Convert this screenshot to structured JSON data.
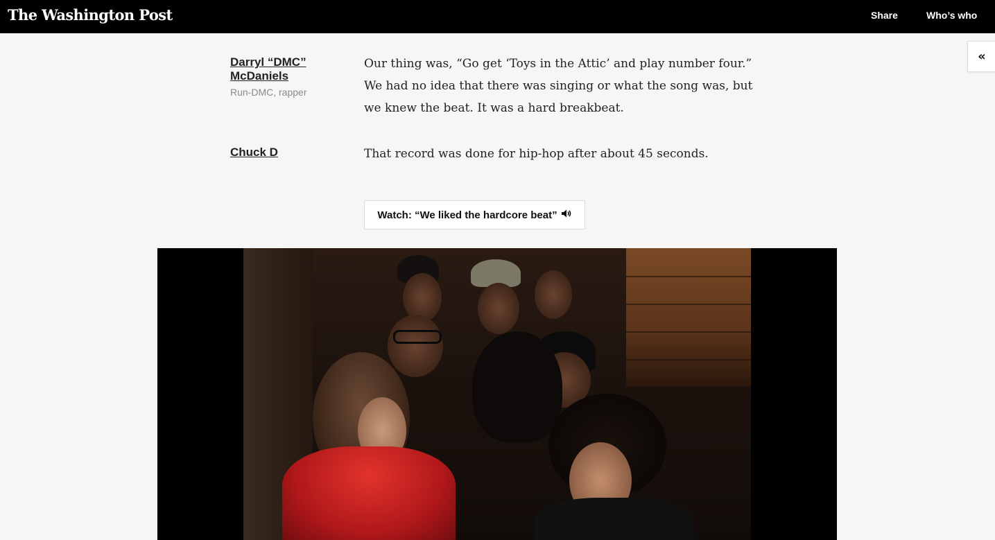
{
  "header": {
    "logo": "The Washington Post",
    "nav": {
      "share": "Share",
      "whos_who": "Who’s who"
    }
  },
  "sidebar_toggle": {
    "icon": "double-chevron-left-icon",
    "glyph": "«"
  },
  "conversation": [
    {
      "speaker": "Darryl “DMC” McDaniels",
      "role": "Run-DMC, rapper",
      "quote": "Our thing was, “Go get ‘Toys in the Attic’ and play number four.” We had no idea that there was singing or what the song was, but we knew the beat. It was a hard breakbeat."
    },
    {
      "speaker": "Chuck D",
      "role": "",
      "quote": "That record was done for hip-hop after about 45 seconds."
    }
  ],
  "watch_button": {
    "label": "Watch: “We liked the hardcore beat”",
    "icon": "speaker-icon"
  },
  "video": {
    "icon": "video-frame"
  }
}
